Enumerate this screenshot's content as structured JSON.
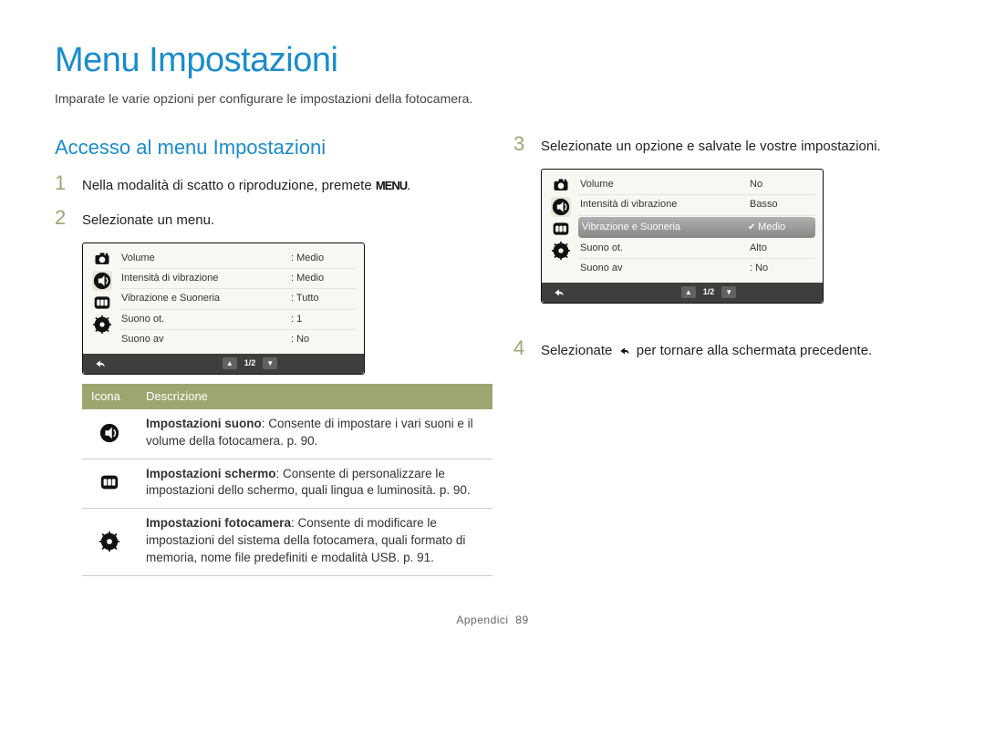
{
  "page": {
    "title": "Menu Impostazioni",
    "intro": "Imparate le varie opzioni per configurare le impostazioni della fotocamera.",
    "subtitle": "Accesso al menu Impostazioni"
  },
  "steps": {
    "1": {
      "num": "1",
      "text_before": "Nella modalità di scatto o riproduzione, premete ",
      "menu_glyph": "MENU",
      "text_after": "."
    },
    "2": {
      "num": "2",
      "text": "Selezionate un menu."
    },
    "3": {
      "num": "3",
      "text": "Selezionate un opzione e salvate le vostre impostazioni."
    },
    "4": {
      "num": "4",
      "text_before": "Selezionate ",
      "text_after": " per tornare alla schermata precedente."
    }
  },
  "screen1": {
    "rows": [
      {
        "label": "Volume",
        "value": ": Medio"
      },
      {
        "label": "Intensità di vibrazione",
        "value": ": Medio"
      },
      {
        "label": "Vibrazione e Suoneria",
        "value": ": Tutto"
      },
      {
        "label": "Suono ot.",
        "value": ": 1"
      },
      {
        "label": "Suono av",
        "value": ": No"
      }
    ],
    "page": "1/2"
  },
  "screen2": {
    "rows": [
      {
        "label": "Volume",
        "value": "No"
      },
      {
        "label": "Intensità di vibrazione",
        "value": "Basso"
      },
      {
        "label": "Vibrazione e Suoneria",
        "value": "Medio",
        "selected": true
      },
      {
        "label": "Suono ot.",
        "value": "Alto"
      },
      {
        "label": "Suono av",
        "value": ": No"
      }
    ],
    "page": "1/2"
  },
  "icon_table": {
    "header": {
      "icon": "Icona",
      "desc": "Descrizione"
    },
    "rows": [
      {
        "icon": "sound",
        "title": "Impostazioni suono",
        "text": ": Consente di impostare i vari suoni e il volume della fotocamera. p. 90."
      },
      {
        "icon": "display",
        "title": "Impostazioni schermo",
        "text": ": Consente di personalizzare le impostazioni dello schermo, quali lingua e luminosità. p. 90."
      },
      {
        "icon": "gear",
        "title": "Impostazioni fotocamera",
        "text": ": Consente di modificare le impostazioni del sistema della fotocamera, quali formato di memoria, nome file predefiniti e modalità USB. p. 91."
      }
    ]
  },
  "footer": {
    "section": "Appendici",
    "page": "89"
  }
}
